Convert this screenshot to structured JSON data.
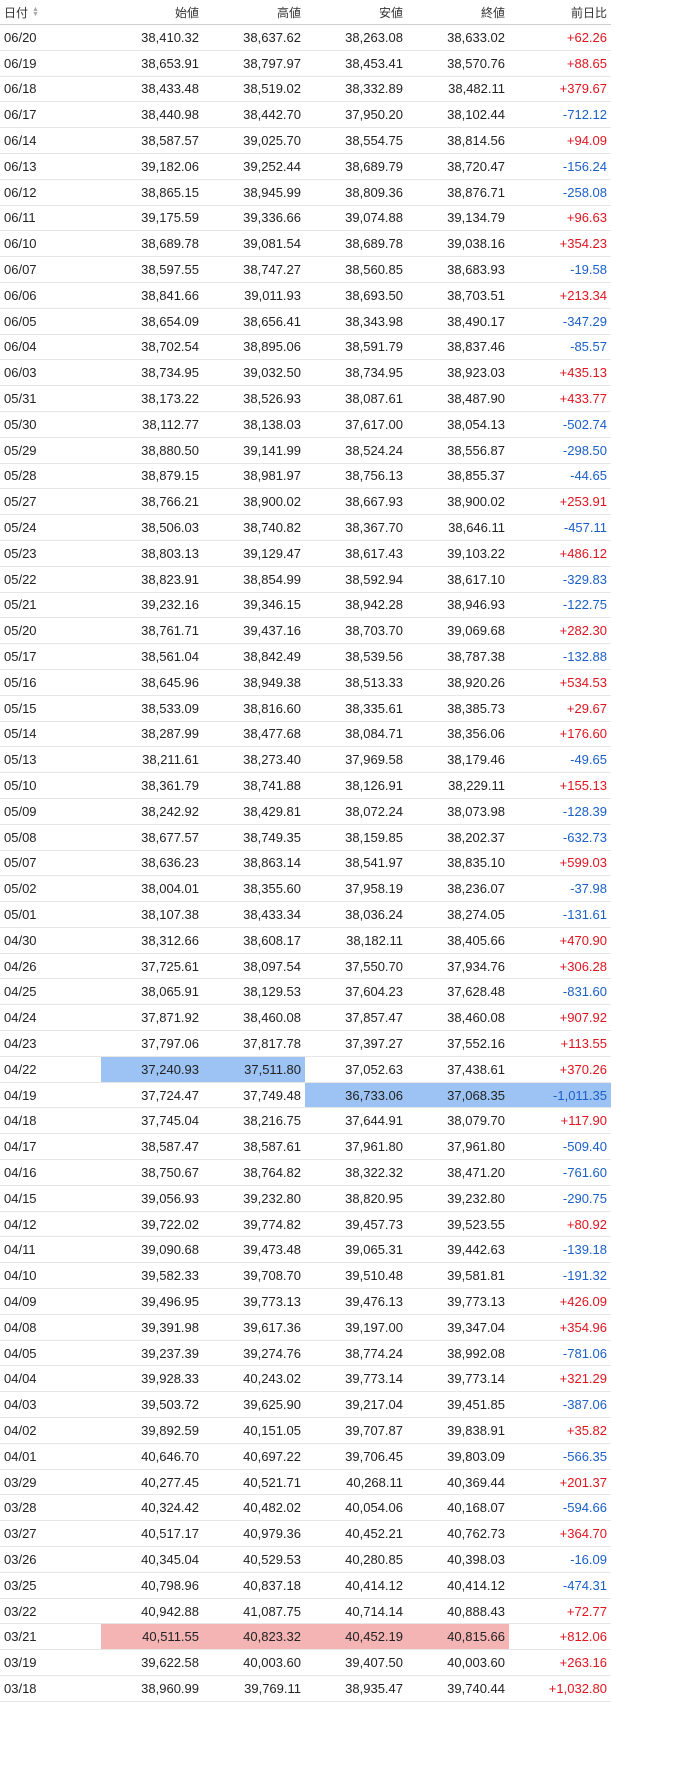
{
  "table": {
    "headers": [
      "日付",
      "始値",
      "高値",
      "安値",
      "終値",
      "前日比"
    ],
    "sort_icons": {
      "up": "▲",
      "down": "▼"
    },
    "colors": {
      "positive": "#e0141e",
      "negative": "#1a5fc8",
      "highlight_blue": "#9cc3f3",
      "highlight_red": "#f4b4b4"
    },
    "rows": [
      [
        "06/20",
        "38,410.32",
        "38,637.62",
        "38,263.08",
        "38,633.02",
        "+62.26"
      ],
      [
        "06/19",
        "38,653.91",
        "38,797.97",
        "38,453.41",
        "38,570.76",
        "+88.65"
      ],
      [
        "06/18",
        "38,433.48",
        "38,519.02",
        "38,332.89",
        "38,482.11",
        "+379.67"
      ],
      [
        "06/17",
        "38,440.98",
        "38,442.70",
        "37,950.20",
        "38,102.44",
        "-712.12"
      ],
      [
        "06/14",
        "38,587.57",
        "39,025.70",
        "38,554.75",
        "38,814.56",
        "+94.09"
      ],
      [
        "06/13",
        "39,182.06",
        "39,252.44",
        "38,689.79",
        "38,720.47",
        "-156.24"
      ],
      [
        "06/12",
        "38,865.15",
        "38,945.99",
        "38,809.36",
        "38,876.71",
        "-258.08"
      ],
      [
        "06/11",
        "39,175.59",
        "39,336.66",
        "39,074.88",
        "39,134.79",
        "+96.63"
      ],
      [
        "06/10",
        "38,689.78",
        "39,081.54",
        "38,689.78",
        "39,038.16",
        "+354.23"
      ],
      [
        "06/07",
        "38,597.55",
        "38,747.27",
        "38,560.85",
        "38,683.93",
        "-19.58"
      ],
      [
        "06/06",
        "38,841.66",
        "39,011.93",
        "38,693.50",
        "38,703.51",
        "+213.34"
      ],
      [
        "06/05",
        "38,654.09",
        "38,656.41",
        "38,343.98",
        "38,490.17",
        "-347.29"
      ],
      [
        "06/04",
        "38,702.54",
        "38,895.06",
        "38,591.79",
        "38,837.46",
        "-85.57"
      ],
      [
        "06/03",
        "38,734.95",
        "39,032.50",
        "38,734.95",
        "38,923.03",
        "+435.13"
      ],
      [
        "05/31",
        "38,173.22",
        "38,526.93",
        "38,087.61",
        "38,487.90",
        "+433.77"
      ],
      [
        "05/30",
        "38,112.77",
        "38,138.03",
        "37,617.00",
        "38,054.13",
        "-502.74"
      ],
      [
        "05/29",
        "38,880.50",
        "39,141.99",
        "38,524.24",
        "38,556.87",
        "-298.50"
      ],
      [
        "05/28",
        "38,879.15",
        "38,981.97",
        "38,756.13",
        "38,855.37",
        "-44.65"
      ],
      [
        "05/27",
        "38,766.21",
        "38,900.02",
        "38,667.93",
        "38,900.02",
        "+253.91"
      ],
      [
        "05/24",
        "38,506.03",
        "38,740.82",
        "38,367.70",
        "38,646.11",
        "-457.11"
      ],
      [
        "05/23",
        "38,803.13",
        "39,129.47",
        "38,617.43",
        "39,103.22",
        "+486.12"
      ],
      [
        "05/22",
        "38,823.91",
        "38,854.99",
        "38,592.94",
        "38,617.10",
        "-329.83"
      ],
      [
        "05/21",
        "39,232.16",
        "39,346.15",
        "38,942.28",
        "38,946.93",
        "-122.75"
      ],
      [
        "05/20",
        "38,761.71",
        "39,437.16",
        "38,703.70",
        "39,069.68",
        "+282.30"
      ],
      [
        "05/17",
        "38,561.04",
        "38,842.49",
        "38,539.56",
        "38,787.38",
        "-132.88"
      ],
      [
        "05/16",
        "38,645.96",
        "38,949.38",
        "38,513.33",
        "38,920.26",
        "+534.53"
      ],
      [
        "05/15",
        "38,533.09",
        "38,816.60",
        "38,335.61",
        "38,385.73",
        "+29.67"
      ],
      [
        "05/14",
        "38,287.99",
        "38,477.68",
        "38,084.71",
        "38,356.06",
        "+176.60"
      ],
      [
        "05/13",
        "38,211.61",
        "38,273.40",
        "37,969.58",
        "38,179.46",
        "-49.65"
      ],
      [
        "05/10",
        "38,361.79",
        "38,741.88",
        "38,126.91",
        "38,229.11",
        "+155.13"
      ],
      [
        "05/09",
        "38,242.92",
        "38,429.81",
        "38,072.24",
        "38,073.98",
        "-128.39"
      ],
      [
        "05/08",
        "38,677.57",
        "38,749.35",
        "38,159.85",
        "38,202.37",
        "-632.73"
      ],
      [
        "05/07",
        "38,636.23",
        "38,863.14",
        "38,541.97",
        "38,835.10",
        "+599.03"
      ],
      [
        "05/02",
        "38,004.01",
        "38,355.60",
        "37,958.19",
        "38,236.07",
        "-37.98"
      ],
      [
        "05/01",
        "38,107.38",
        "38,433.34",
        "38,036.24",
        "38,274.05",
        "-131.61"
      ],
      [
        "04/30",
        "38,312.66",
        "38,608.17",
        "38,182.11",
        "38,405.66",
        "+470.90"
      ],
      [
        "04/26",
        "37,725.61",
        "38,097.54",
        "37,550.70",
        "37,934.76",
        "+306.28"
      ],
      [
        "04/25",
        "38,065.91",
        "38,129.53",
        "37,604.23",
        "37,628.48",
        "-831.60"
      ],
      [
        "04/24",
        "37,871.92",
        "38,460.08",
        "37,857.47",
        "38,460.08",
        "+907.92"
      ],
      [
        "04/23",
        "37,797.06",
        "37,817.78",
        "37,397.27",
        "37,552.16",
        "+113.55"
      ],
      [
        "04/22",
        "37,240.93",
        "37,511.80",
        "37,052.63",
        "37,438.61",
        "+370.26"
      ],
      [
        "04/19",
        "37,724.47",
        "37,749.48",
        "36,733.06",
        "37,068.35",
        "-1,011.35"
      ],
      [
        "04/18",
        "37,745.04",
        "38,216.75",
        "37,644.91",
        "38,079.70",
        "+117.90"
      ],
      [
        "04/17",
        "38,587.47",
        "38,587.61",
        "37,961.80",
        "37,961.80",
        "-509.40"
      ],
      [
        "04/16",
        "38,750.67",
        "38,764.82",
        "38,322.32",
        "38,471.20",
        "-761.60"
      ],
      [
        "04/15",
        "39,056.93",
        "39,232.80",
        "38,820.95",
        "39,232.80",
        "-290.75"
      ],
      [
        "04/12",
        "39,722.02",
        "39,774.82",
        "39,457.73",
        "39,523.55",
        "+80.92"
      ],
      [
        "04/11",
        "39,090.68",
        "39,473.48",
        "39,065.31",
        "39,442.63",
        "-139.18"
      ],
      [
        "04/10",
        "39,582.33",
        "39,708.70",
        "39,510.48",
        "39,581.81",
        "-191.32"
      ],
      [
        "04/09",
        "39,496.95",
        "39,773.13",
        "39,476.13",
        "39,773.13",
        "+426.09"
      ],
      [
        "04/08",
        "39,391.98",
        "39,617.36",
        "39,197.00",
        "39,347.04",
        "+354.96"
      ],
      [
        "04/05",
        "39,237.39",
        "39,274.76",
        "38,774.24",
        "38,992.08",
        "-781.06"
      ],
      [
        "04/04",
        "39,928.33",
        "40,243.02",
        "39,773.14",
        "39,773.14",
        "+321.29"
      ],
      [
        "04/03",
        "39,503.72",
        "39,625.90",
        "39,217.04",
        "39,451.85",
        "-387.06"
      ],
      [
        "04/02",
        "39,892.59",
        "40,151.05",
        "39,707.87",
        "39,838.91",
        "+35.82"
      ],
      [
        "04/01",
        "40,646.70",
        "40,697.22",
        "39,706.45",
        "39,803.09",
        "-566.35"
      ],
      [
        "03/29",
        "40,277.45",
        "40,521.71",
        "40,268.11",
        "40,369.44",
        "+201.37"
      ],
      [
        "03/28",
        "40,324.42",
        "40,482.02",
        "40,054.06",
        "40,168.07",
        "-594.66"
      ],
      [
        "03/27",
        "40,517.17",
        "40,979.36",
        "40,452.21",
        "40,762.73",
        "+364.70"
      ],
      [
        "03/26",
        "40,345.04",
        "40,529.53",
        "40,280.85",
        "40,398.03",
        "-16.09"
      ],
      [
        "03/25",
        "40,798.96",
        "40,837.18",
        "40,414.12",
        "40,414.12",
        "-474.31"
      ],
      [
        "03/22",
        "40,942.88",
        "41,087.75",
        "40,714.14",
        "40,888.43",
        "+72.77"
      ],
      [
        "03/21",
        "40,511.55",
        "40,823.32",
        "40,452.19",
        "40,815.66",
        "+812.06"
      ],
      [
        "03/19",
        "39,622.58",
        "40,003.60",
        "39,407.50",
        "40,003.60",
        "+263.16"
      ],
      [
        "03/18",
        "38,960.99",
        "39,769.11",
        "38,935.47",
        "39,740.44",
        "+1,032.80"
      ]
    ],
    "highlights": [
      {
        "row": 40,
        "cols": [
          1,
          2
        ],
        "color": "blue"
      },
      {
        "row": 41,
        "cols": [
          3,
          4,
          5
        ],
        "color": "blue"
      },
      {
        "row": 62,
        "cols": [
          1,
          2,
          3,
          4
        ],
        "color": "red"
      },
      {
        "row": 65,
        "cols": [
          5
        ],
        "color": "red"
      }
    ]
  }
}
